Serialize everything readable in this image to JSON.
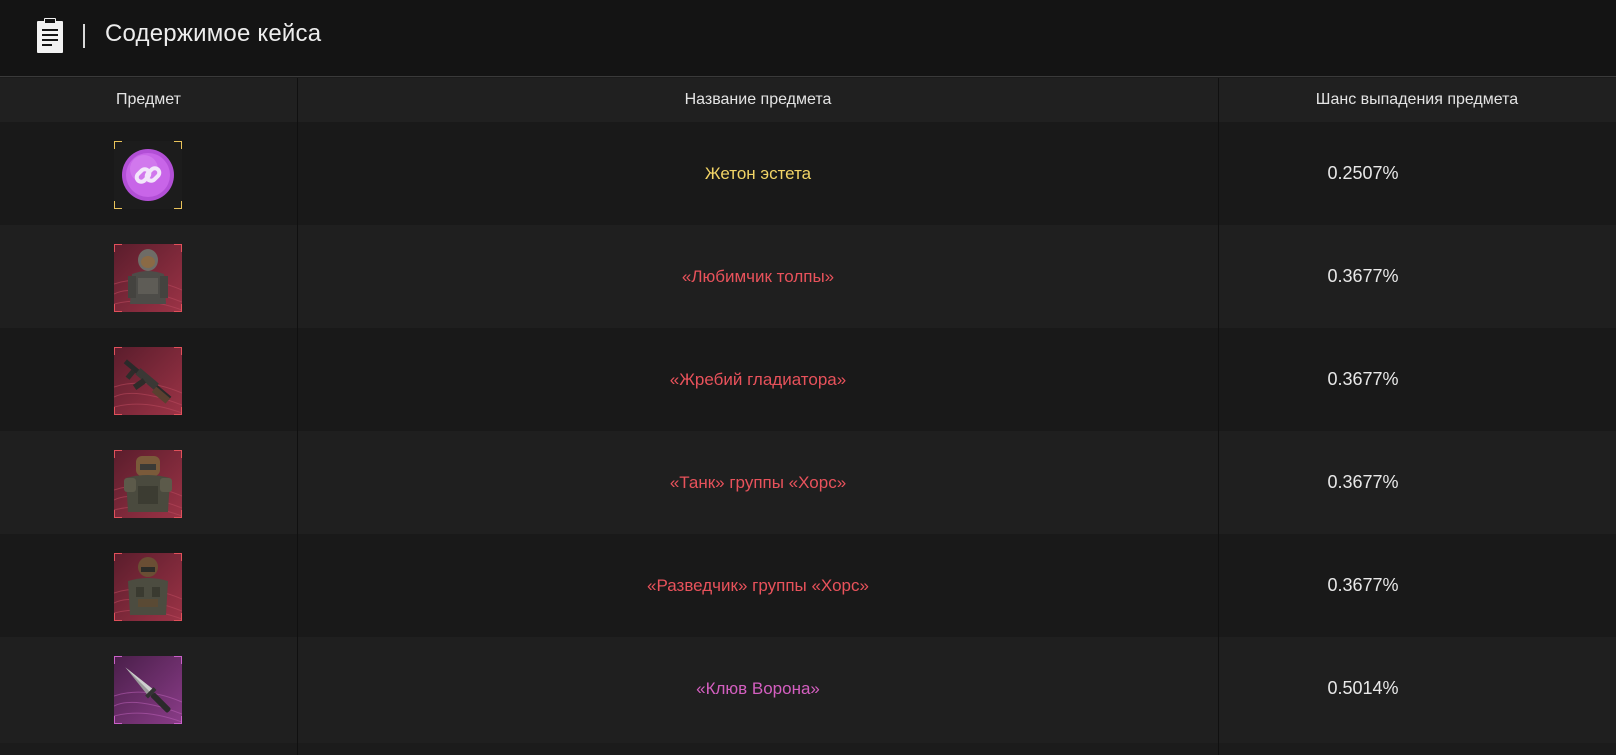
{
  "header": {
    "title": "Содержимое кейса",
    "icon": "clipboard-icon"
  },
  "table": {
    "columns": [
      "Предмет",
      "Название предмета",
      "Шанс выпадения предмета"
    ],
    "rows": [
      {
        "name": "Жетон эстета",
        "chance": "0.2507%",
        "name_color": "#f2d466",
        "frame_color": "#e8c25a",
        "icon": "purple-token-chain-icon"
      },
      {
        "name": "«Любимчик толпы»",
        "chance": "0.3677%",
        "name_color": "#e8525b",
        "frame_color": "#e0505a",
        "icon": "armored-soldier-icon"
      },
      {
        "name": "«Жребий гладиатора»",
        "chance": "0.3677%",
        "name_color": "#e8525b",
        "frame_color": "#e0505a",
        "icon": "assault-rifle-icon"
      },
      {
        "name": "«Танк» группы «Хорс»",
        "chance": "0.3677%",
        "name_color": "#e8525b",
        "frame_color": "#e0505a",
        "icon": "heavy-armor-soldier-icon"
      },
      {
        "name": "«Разведчик» группы «Хорс»",
        "chance": "0.3677%",
        "name_color": "#e8525b",
        "frame_color": "#e0505a",
        "icon": "scout-soldier-icon"
      },
      {
        "name": "«Клюв Ворона»",
        "chance": "0.5014%",
        "name_color": "#d45fc0",
        "frame_color": "#c960c8",
        "icon": "combat-knife-icon"
      }
    ]
  }
}
